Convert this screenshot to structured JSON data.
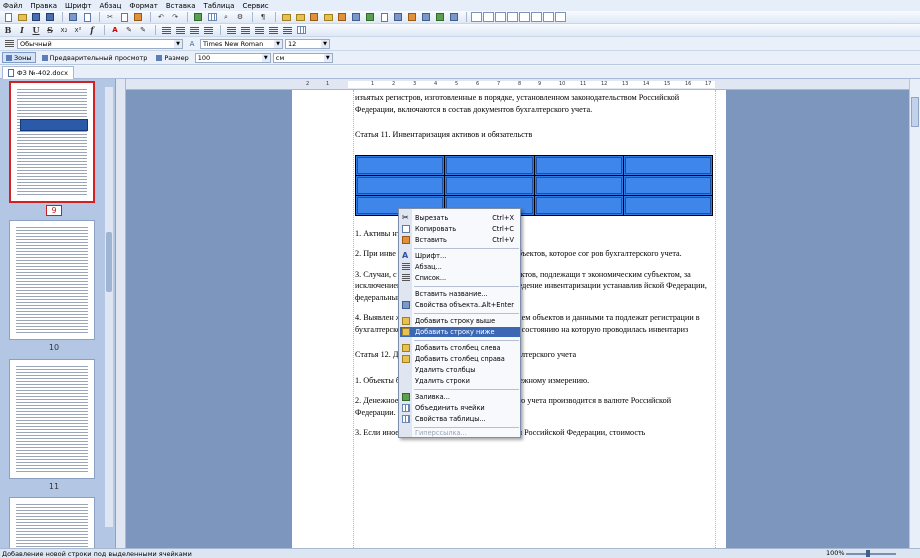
{
  "menu": [
    "Файл",
    "Правка",
    "Шрифт",
    "Абзац",
    "Формат",
    "Вставка",
    "Таблица",
    "Сервис"
  ],
  "toolbar2": {
    "bold": "B",
    "italic": "I",
    "underline": "U",
    "strike": "S",
    "subscript": "x₂",
    "superscript": "x²",
    "formula": "f"
  },
  "format": {
    "style": "Обычный",
    "font": "Times New Roman",
    "size": "12"
  },
  "viewbar": {
    "borders": "Зоны",
    "preview": "Предварительный просмотр",
    "size_label": "Размер",
    "size_value": "100",
    "unit_value": "см"
  },
  "tab": {
    "filename": "ФЗ №-402.docx"
  },
  "thumbnails": [
    {
      "num": "9"
    },
    {
      "num": "10"
    },
    {
      "num": "11"
    }
  ],
  "ruler": {
    "marks": [
      "2",
      "1",
      "1",
      "2",
      "3",
      "4",
      "5",
      "6",
      "7",
      "8",
      "9",
      "10",
      "11",
      "12",
      "13",
      "14",
      "15",
      "16",
      "17"
    ]
  },
  "document": {
    "p0": "изъятых регистров, изготовленные в порядке, установленном законодательством Российской Федерации, включаются в состав документов бухгалтерского учета.",
    "h11": "Статья 11. Инвентаризация активов и обязательств",
    "p1": "1. Активы                                                                              нтаризации.",
    "p2": "2. При инве                                                                            еское наличие соответствующих объектов, которое сог                                                                              ров бухгалтерского учета.",
    "p3": "3. Случаи, с                                                                           нтаризации, а также перечень объектов, подлежащи                                                                              т экономическим субъектом, за исключением обязательн                                                                              и. Обязательное проведение инвентаризации устанавлив                                                                              йской Федерации, федеральными и отраслевы",
    "p4": "4. Выявлен                                                                             ждения между фактическим наличием объектов и данными                                                                             та подлежат регистрации в бухгалтерском учете в том отчетно                                                                             тся дата, по состоянию на которую проводилась инвентариз",
    "h12": "Статья 12. Денежное измерение объектов бухгалтерского учета",
    "p5": "1. Объекты бухгалтерского учета подлежат денежному измерению.",
    "p6": "2. Денежное измерение объектов бухгалтерского учета производится в валюте Российской Федерации.",
    "p7": "3. Если иное не установлено законодательством Российской Федерации, стоимость"
  },
  "context_menu": {
    "cut": "Вырезать",
    "cut_sc": "Ctrl+X",
    "copy": "Копировать",
    "copy_sc": "Ctrl+C",
    "paste": "Вставить",
    "paste_sc": "Ctrl+V",
    "font": "Шрифт...",
    "paragraph": "Абзац...",
    "list": "Список...",
    "caption": "Вставить название...",
    "object_props": "Свойства объекта...",
    "object_props_sc": "Alt+Enter",
    "row_above": "Добавить строку выше",
    "row_below": "Добавить строку ниже",
    "col_left": "Добавить столбец слева",
    "col_right": "Добавить столбец справа",
    "del_cols": "Удалить столбцы",
    "del_rows": "Удалить строки",
    "fill": "Заливка...",
    "merge": "Объединить ячейки",
    "table_props": "Свойства таблицы...",
    "hyperlink": "Гиперссылка..."
  },
  "status": {
    "text": "Добавление новой строки под выделенными ячейками",
    "zoom": "100%"
  },
  "colors": {
    "selection": "#2f7be2",
    "menu_highlight": "#3b67b5",
    "canvas": "#7d96bd",
    "sidebar": "#b3c7e5"
  }
}
